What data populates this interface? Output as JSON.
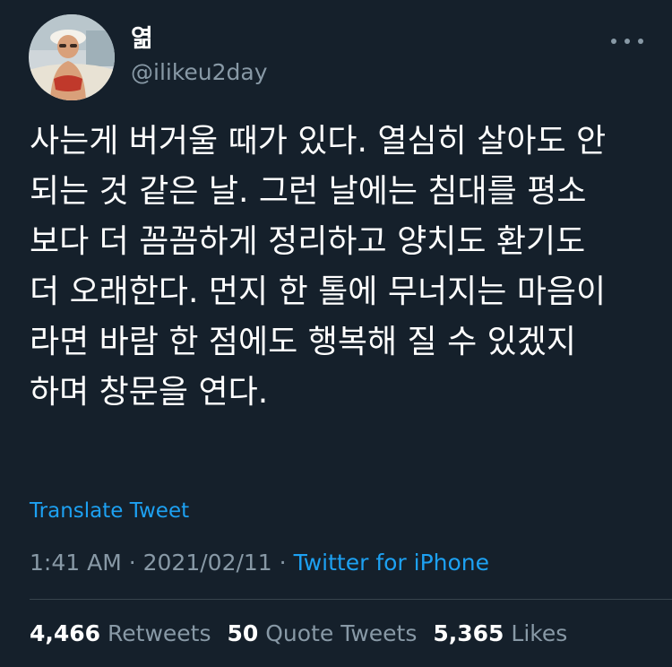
{
  "tweet": {
    "display_name": "엶",
    "handle": "@ilikeu2day",
    "text": "사는게 버거울 때가 있다. 열심히 살아도 안\n되는 것 같은 날. 그런 날에는 침대를 평소\n보다 더 꼼꼼하게 정리하고 양치도 환기도\n더 오래한다. 먼지 한 톨에 무너지는 마음이\n라면 바람 한 점에도 행복해 질 수 있겠지\n하며 창문을 연다.",
    "translate_label": "Translate Tweet",
    "time": "1:41 AM",
    "date": "2021/02/11",
    "source": "Twitter for iPhone",
    "separator": "·"
  },
  "stats": {
    "retweets_count": "4,466",
    "retweets_label": "Retweets",
    "quotes_count": "50",
    "quotes_label": "Quote Tweets",
    "likes_count": "5,365",
    "likes_label": "Likes"
  },
  "icons": {
    "more": "more-horizontal-icon",
    "avatar": "profile-photo"
  },
  "colors": {
    "background": "#15202b",
    "text": "#ffffff",
    "secondary": "#8899a6",
    "accent": "#1da1f2",
    "divider": "#38444d"
  }
}
